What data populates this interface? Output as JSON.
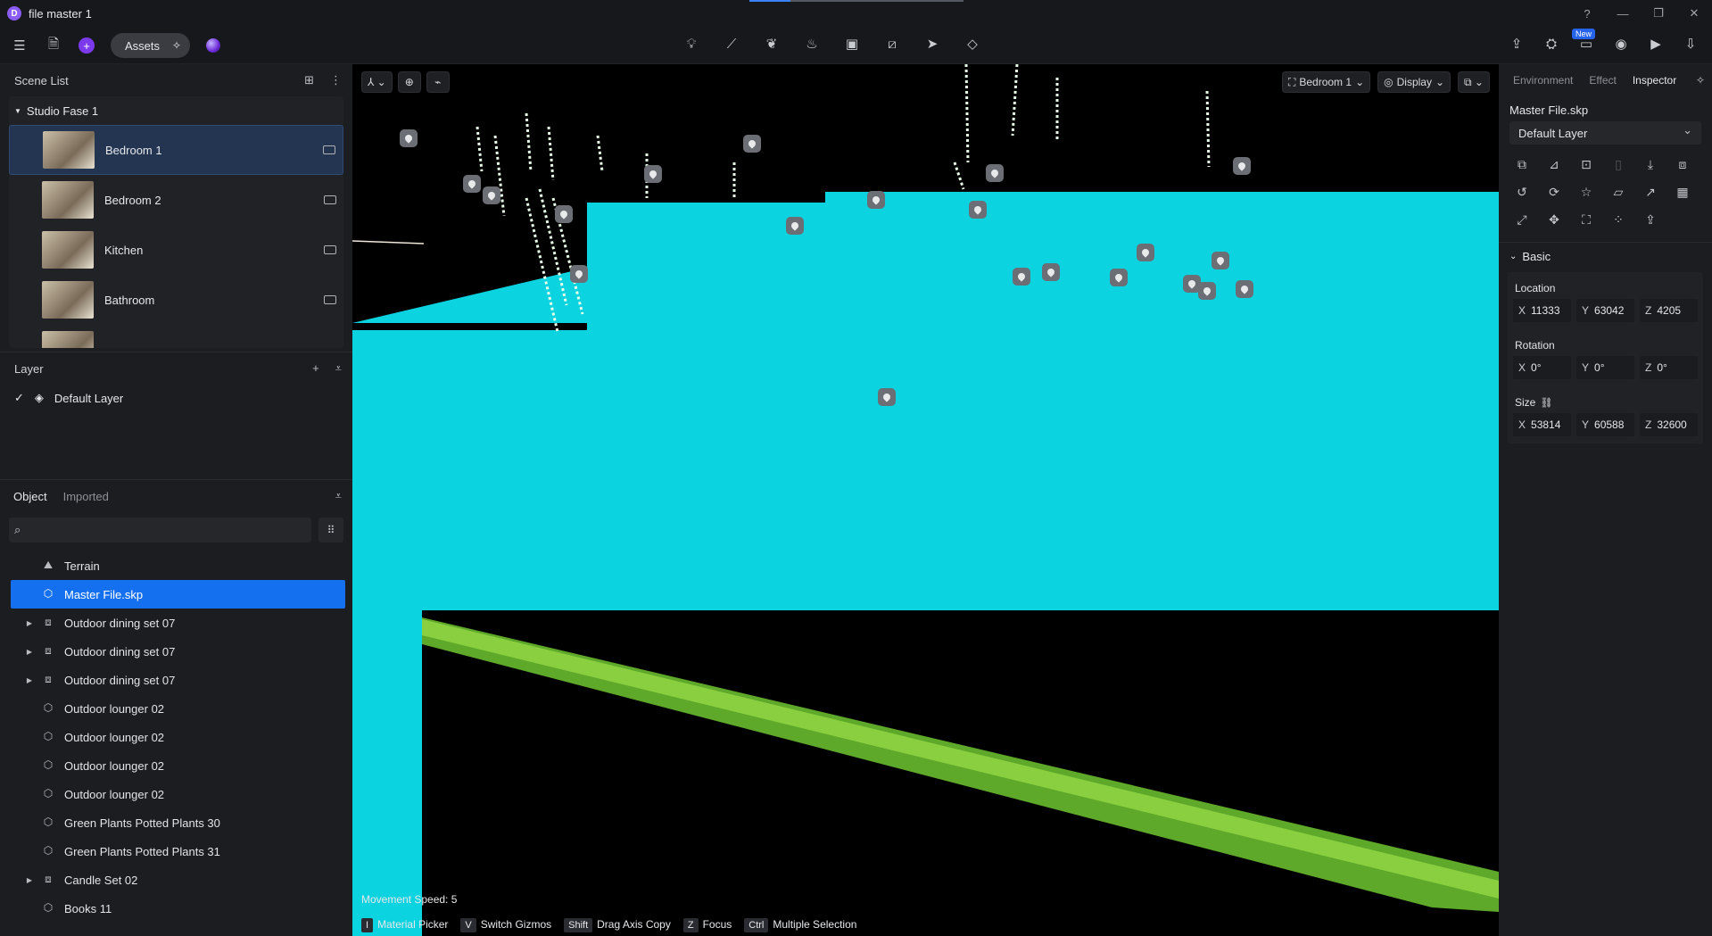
{
  "window": {
    "title": "file master 1",
    "progress": 0.19
  },
  "toolbar": {
    "assets_label": "Assets",
    "new_badge": "New"
  },
  "scene_list": {
    "title": "Scene List",
    "group": "Studio Fase 1",
    "items": [
      {
        "name": "Bedroom 1"
      },
      {
        "name": "Bedroom 2"
      },
      {
        "name": "Kitchen"
      },
      {
        "name": "Bathroom"
      }
    ]
  },
  "layer_panel": {
    "title": "Layer",
    "layers": [
      {
        "name": "Default Layer"
      }
    ]
  },
  "object_panel": {
    "tabs": [
      "Object",
      "Imported"
    ],
    "items": [
      {
        "name": "Terrain",
        "icon": "terrain-icon",
        "expandable": false
      },
      {
        "name": "Master File.skp",
        "icon": "cube-icon",
        "expandable": false,
        "selected": true
      },
      {
        "name": "Outdoor dining set 07",
        "icon": "group-icon",
        "expandable": true
      },
      {
        "name": "Outdoor dining set 07",
        "icon": "group-icon",
        "expandable": true
      },
      {
        "name": "Outdoor dining set 07",
        "icon": "group-icon",
        "expandable": true
      },
      {
        "name": "Outdoor lounger 02",
        "icon": "cube-icon",
        "expandable": false
      },
      {
        "name": "Outdoor lounger 02",
        "icon": "cube-icon",
        "expandable": false
      },
      {
        "name": "Outdoor lounger 02",
        "icon": "cube-icon",
        "expandable": false
      },
      {
        "name": "Outdoor lounger 02",
        "icon": "cube-icon",
        "expandable": false
      },
      {
        "name": "Green Plants Potted Plants 30",
        "icon": "cube-icon",
        "expandable": false
      },
      {
        "name": "Green Plants Potted Plants 31",
        "icon": "cube-icon",
        "expandable": false
      },
      {
        "name": "Candle Set 02",
        "icon": "group-icon",
        "expandable": true
      },
      {
        "name": "Books 11",
        "icon": "cube-icon",
        "expandable": false
      }
    ]
  },
  "viewport": {
    "camera_label": "Bedroom 1",
    "display_label": "Display",
    "movement_speed": "Movement Speed: 5",
    "hints": [
      {
        "key": "I",
        "label": "Material Picker"
      },
      {
        "key": "V",
        "label": "Switch Gizmos"
      },
      {
        "key": "Shift",
        "label": "Drag Axis Copy"
      },
      {
        "key": "Z",
        "label": "Focus"
      },
      {
        "key": "Ctrl",
        "label": "Multiple Selection"
      }
    ],
    "colors": {
      "selection": "#0cd3e0",
      "background": "#000000",
      "grass": "#7bd63a"
    }
  },
  "inspector": {
    "tabs": [
      "Environment",
      "Effect",
      "Inspector"
    ],
    "active_tab": "Inspector",
    "object_name": "Master File.skp",
    "layer": "Default Layer",
    "section": "Basic",
    "location": {
      "label": "Location",
      "x": "11333",
      "y": "63042",
      "z": "4205"
    },
    "rotation": {
      "label": "Rotation",
      "x": "0°",
      "y": "0°",
      "z": "0°"
    },
    "size": {
      "label": "Size",
      "x": "53814",
      "y": "60588",
      "z": "32600"
    }
  }
}
